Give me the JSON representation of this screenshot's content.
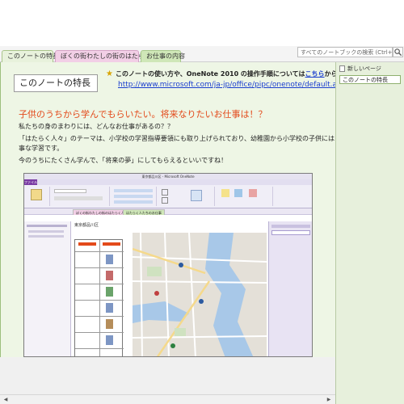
{
  "tabs": [
    {
      "label": "このノートの特長"
    },
    {
      "label": "ぼくの街わたしの街のはたらく人"
    },
    {
      "label": "お仕事の内容"
    }
  ],
  "search": {
    "placeholder": "すべてのノートブックの検索 (Ctrl+E)"
  },
  "page": {
    "title": "このノートの特長",
    "note_prefix": "このノートの使い方や、OneNote 2010 の操作手順については",
    "note_link": "こちら",
    "note_suffix": "から",
    "url": "http://www.microsoft.com/ja-jp/office/pipc/onenote/default.aspx",
    "headline": "子供のうちから学んでもらいたい。将来なりたいお仕事は！？",
    "paragraphs": [
      "私たちの身のまわりには、どんなお仕事があるの？？",
      "「はたらく人々」のテーマは、小学校の学習指導要領にも取り上げられており、幼稚園から小学校の子供にはとても大",
      "事な学習です。",
      "今のうちにたくさん学んで、「将来の夢」にしてもらえるといいですね！"
    ]
  },
  "screenshot": {
    "window_title": "東京都品川区 - Microsoft OneNote",
    "file_tab": "ファイル",
    "tab1": "ぼくの街わたしの街のはたらく人",
    "tab2": "はたらく人たちのお仕事",
    "page_heading": "東京都品川区"
  },
  "right_panel": {
    "new_page": "新しいページ",
    "page_item": "このノートの特長"
  },
  "colors": {
    "page_bg": "#eef6e5",
    "headline": "#e34a1b",
    "link": "#1a3ecf"
  }
}
